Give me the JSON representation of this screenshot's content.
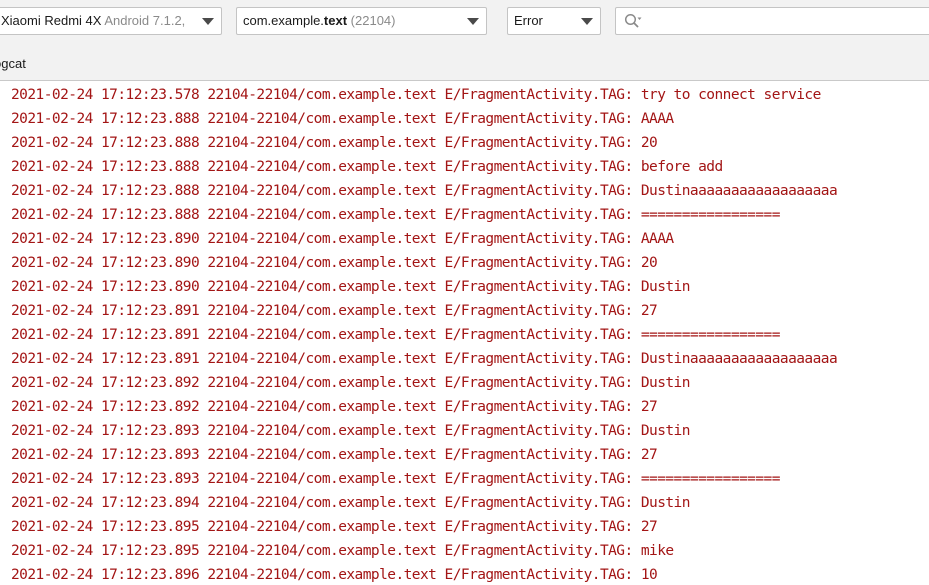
{
  "toolbar": {
    "device": {
      "name": "Xiaomi Redmi 4X",
      "version": "Android 7.1.2,"
    },
    "process": {
      "package_prefix": "com.example.",
      "package_bold": "text",
      "pid": "(22104)"
    },
    "log_level": "Error",
    "search": {
      "value": "",
      "placeholder": ""
    }
  },
  "tabs": {
    "logcat_label": "ogcat"
  },
  "log": {
    "lines": [
      "2021-02-24 17:12:23.578 22104-22104/com.example.text E/FragmentActivity.TAG: try to connect service",
      "2021-02-24 17:12:23.888 22104-22104/com.example.text E/FragmentActivity.TAG: AAAA",
      "2021-02-24 17:12:23.888 22104-22104/com.example.text E/FragmentActivity.TAG: 20",
      "2021-02-24 17:12:23.888 22104-22104/com.example.text E/FragmentActivity.TAG: before add",
      "2021-02-24 17:12:23.888 22104-22104/com.example.text E/FragmentActivity.TAG: Dustinaaaaaaaaaaaaaaaaaa",
      "2021-02-24 17:12:23.888 22104-22104/com.example.text E/FragmentActivity.TAG: =================",
      "2021-02-24 17:12:23.890 22104-22104/com.example.text E/FragmentActivity.TAG: AAAA",
      "2021-02-24 17:12:23.890 22104-22104/com.example.text E/FragmentActivity.TAG: 20",
      "2021-02-24 17:12:23.890 22104-22104/com.example.text E/FragmentActivity.TAG: Dustin",
      "2021-02-24 17:12:23.891 22104-22104/com.example.text E/FragmentActivity.TAG: 27",
      "2021-02-24 17:12:23.891 22104-22104/com.example.text E/FragmentActivity.TAG: =================",
      "2021-02-24 17:12:23.891 22104-22104/com.example.text E/FragmentActivity.TAG: Dustinaaaaaaaaaaaaaaaaaa",
      "2021-02-24 17:12:23.892 22104-22104/com.example.text E/FragmentActivity.TAG: Dustin",
      "2021-02-24 17:12:23.892 22104-22104/com.example.text E/FragmentActivity.TAG: 27",
      "2021-02-24 17:12:23.893 22104-22104/com.example.text E/FragmentActivity.TAG: Dustin",
      "2021-02-24 17:12:23.893 22104-22104/com.example.text E/FragmentActivity.TAG: 27",
      "2021-02-24 17:12:23.893 22104-22104/com.example.text E/FragmentActivity.TAG: =================",
      "2021-02-24 17:12:23.894 22104-22104/com.example.text E/FragmentActivity.TAG: Dustin",
      "2021-02-24 17:12:23.895 22104-22104/com.example.text E/FragmentActivity.TAG: 27",
      "2021-02-24 17:12:23.895 22104-22104/com.example.text E/FragmentActivity.TAG: mike",
      "2021-02-24 17:12:23.896 22104-22104/com.example.text E/FragmentActivity.TAG: 10"
    ],
    "error_color": "#a31515"
  },
  "icons": {
    "search": "search-icon",
    "dropdown": "chevron-down-icon"
  }
}
